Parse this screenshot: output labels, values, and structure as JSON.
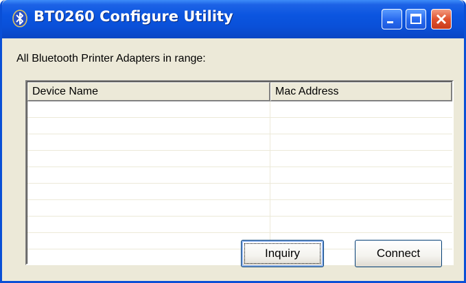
{
  "window": {
    "title": "BT0260 Configure Utility"
  },
  "titlebar": {
    "icon": "bluetooth-icon",
    "buttons": [
      "minimize-icon",
      "maximize-icon",
      "close-icon"
    ]
  },
  "main": {
    "label": "All Bluetooth Printer Adapters in range:",
    "list": {
      "columns": [
        "Device Name",
        "Mac Address"
      ],
      "rows": []
    },
    "buttons": {
      "inquiry": "Inquiry",
      "connect": "Connect"
    }
  },
  "colors": {
    "titlebar": "#0a50d8",
    "window_bg": "#ece9d8",
    "close_button": "#e0522f"
  }
}
